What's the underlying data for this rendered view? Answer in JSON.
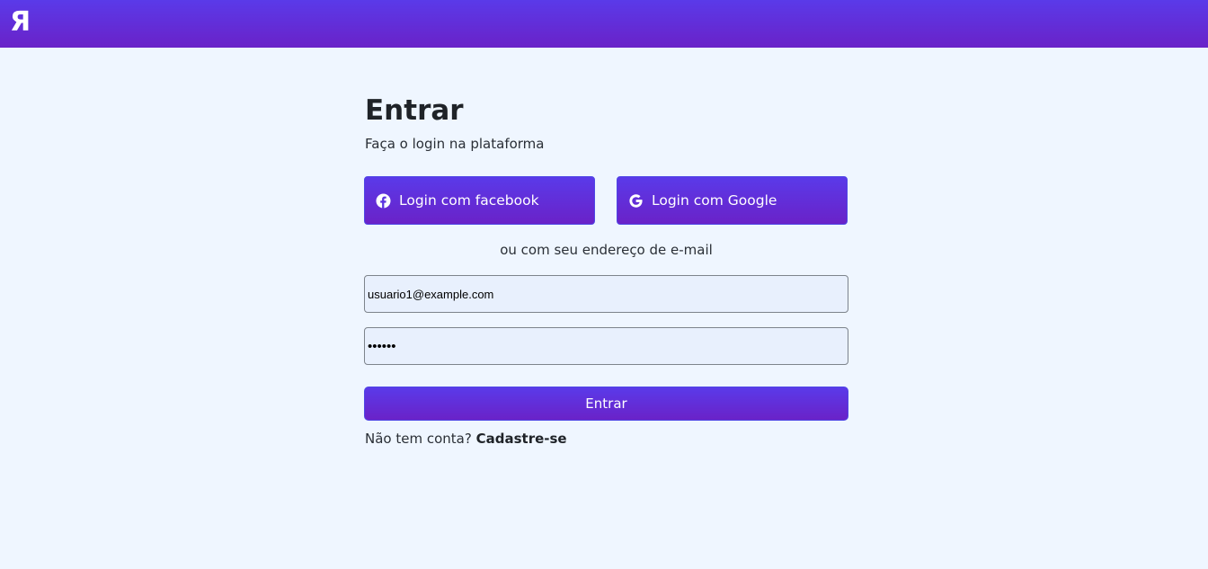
{
  "header": {
    "logo_text": "Я",
    "gradient_start": "#5a3ae9",
    "gradient_end": "#6a22c8"
  },
  "login": {
    "title": "Entrar",
    "subtitle": "Faça o login na plataforma",
    "facebook_button": {
      "label": "Login com facebook",
      "icon": "facebook-icon"
    },
    "google_button": {
      "label": "Login com Google",
      "icon": "google-icon"
    },
    "divider_text": "ou com seu endereço de e-mail",
    "email": {
      "value": "usuario1@example.com"
    },
    "password": {
      "value": "••••••"
    },
    "submit_label": "Entrar",
    "signup_prompt": "Não tem conta?",
    "signup_link": "Cadastre-se"
  },
  "colors": {
    "page_background": "#eff6ff",
    "button_gradient_start": "#5a3ae9",
    "button_gradient_end": "#6a22c8",
    "input_background": "#e8f0fd"
  }
}
